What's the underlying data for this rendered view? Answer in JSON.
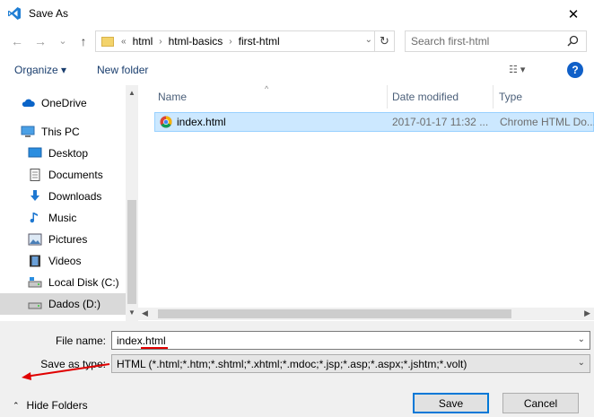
{
  "window": {
    "title": "Save As",
    "close_glyph": "✕",
    "app_icon": "vscode-icon"
  },
  "nav": {
    "back_glyph": "←",
    "forward_glyph": "→",
    "recent_glyph": "⌄",
    "up_glyph": "↑"
  },
  "address": {
    "overflow": "«",
    "crumbs": [
      "html",
      "html-basics",
      "first-html"
    ],
    "separator": "›",
    "dropdown_glyph": "⌄",
    "refresh_glyph": "↻"
  },
  "search": {
    "placeholder": "Search first-html"
  },
  "toolbar": {
    "organize_label": "Organize ▾",
    "new_folder_label": "New folder",
    "views_glyph": "☷ ▾",
    "help_glyph": "?"
  },
  "sidebar": {
    "items": [
      {
        "label": "OneDrive",
        "icon": "cloud-icon"
      },
      {
        "label": "This PC",
        "icon": "computer-icon"
      },
      {
        "label": "Desktop",
        "icon": "desktop-icon"
      },
      {
        "label": "Documents",
        "icon": "documents-icon"
      },
      {
        "label": "Downloads",
        "icon": "downloads-icon"
      },
      {
        "label": "Music",
        "icon": "music-icon"
      },
      {
        "label": "Pictures",
        "icon": "pictures-icon"
      },
      {
        "label": "Videos",
        "icon": "videos-icon"
      },
      {
        "label": "Local Disk (C:)",
        "icon": "local-disk-icon"
      },
      {
        "label": "Dados (D:)",
        "icon": "drive-icon",
        "selected": true
      }
    ]
  },
  "file_list": {
    "columns": {
      "name": "Name",
      "date": "Date modified",
      "type": "Type"
    },
    "sort_glyph": "^",
    "rows": [
      {
        "name": "index.html",
        "date": "2017-01-17 11:32 ...",
        "type": "Chrome HTML Do...",
        "icon": "chrome-icon"
      }
    ]
  },
  "form": {
    "file_name_label": "File name:",
    "file_name_value": "index.html",
    "save_as_type_label": "Save as type:",
    "save_as_type_value": "HTML (*.html;*.htm;*.shtml;*.xhtml;*.mdoc;*.jsp;*.asp;*.aspx;*.jshtm;*.volt)",
    "dropdown_glyph": "⌄",
    "hide_folders_label": "Hide Folders",
    "hide_folders_glyph": "⌃",
    "save_label": "Save",
    "cancel_label": "Cancel"
  },
  "colors": {
    "accent": "#0078d7",
    "selection": "#cce8ff",
    "annotation": "#e00000"
  }
}
